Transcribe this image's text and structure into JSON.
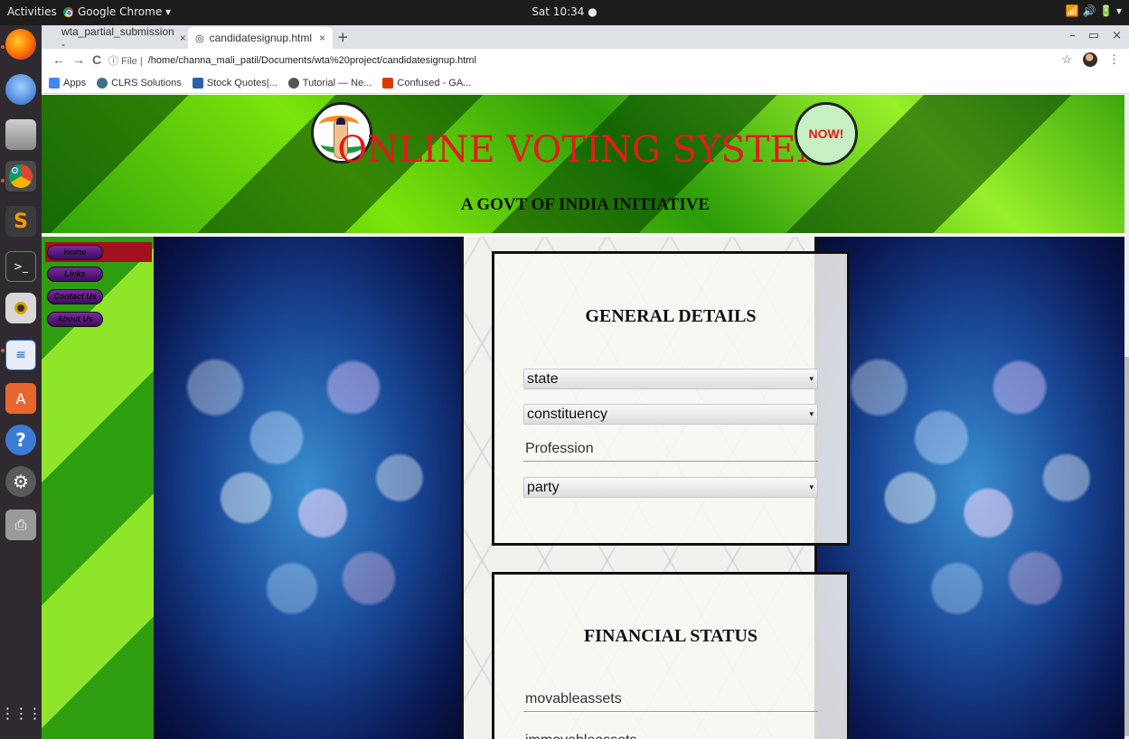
{
  "topbar": {
    "activities": "Activities",
    "app_name": "Google Chrome ▾",
    "clock": "Sat 10:34 ●",
    "sys_icons": "📶 🔊 🔋 ▾"
  },
  "dock": {
    "items": [
      "firefox-icon",
      "thunderbird-icon",
      "files-icon",
      "chrome-icon",
      "sublime-icon",
      "terminal-icon",
      "camera-icon",
      "writer-icon",
      "software-icon",
      "help-icon",
      "settings-icon",
      "printer-icon"
    ],
    "apps_grid_label": "⋮⋮⋮"
  },
  "browser": {
    "tabs": [
      {
        "label": "wta_partial_submission -",
        "close": "×"
      },
      {
        "label": "candidatesignup.html",
        "close": "×"
      }
    ],
    "new_tab": "+",
    "window_controls": [
      "–",
      "▭",
      "×"
    ],
    "nav": {
      "back": "←",
      "forward": "→",
      "reload": "C"
    },
    "url_info": "ⓘ File |",
    "url": "/home/channa_mali_patil/Documents/wta%20project/candidatesignup.html",
    "star": "☆",
    "menu": "⋮",
    "bookmarks": [
      {
        "label": "Apps",
        "color": "#4285f4"
      },
      {
        "label": "CLRS Solutions",
        "color": "#3d6f8c"
      },
      {
        "label": "Stock Quotes|...",
        "color": "#2b5fa8"
      },
      {
        "label": "Tutorial — Ne...",
        "color": "#555555"
      },
      {
        "label": "Confused - GA...",
        "color": "#d83b01"
      }
    ]
  },
  "page": {
    "title": "ONLINE VOTING SYSTEM",
    "subtitle": "A GOVT OF INDIA INITIATIVE",
    "badge": "NOW!",
    "menu": [
      "Home",
      "Links",
      "Contact Us",
      "About Us"
    ],
    "general": {
      "heading": "GENERAL DETAILS",
      "state": "state",
      "constituency": "constituency",
      "profession_placeholder": "Profession",
      "party": "party"
    },
    "financial": {
      "heading": "FINANCIAL STATUS",
      "movable_placeholder": "movableassets",
      "immovable_placeholder": "immovableassets"
    }
  }
}
